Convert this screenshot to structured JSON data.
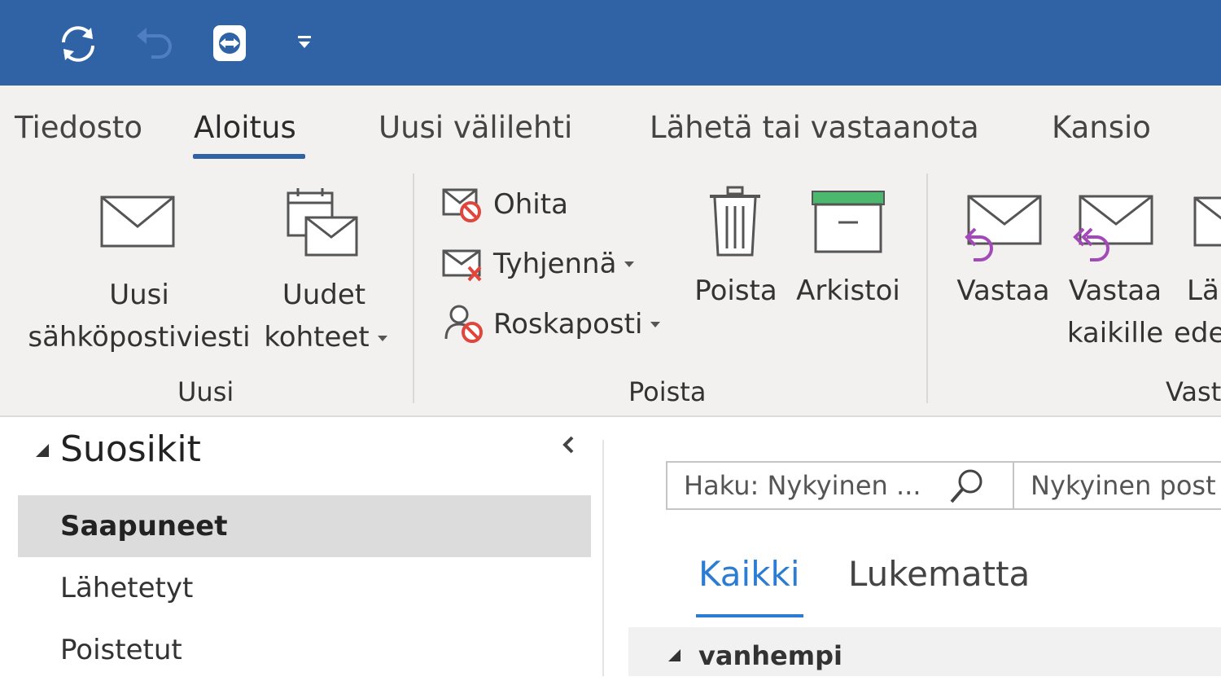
{
  "colors": {
    "titlebar": "#2f63a6",
    "ribbon": "#f2f1f0",
    "accent": "#2b7cd3",
    "reply_purple": "#a24ab8",
    "archive_green": "#4cb86d",
    "block_red": "#e0463c"
  },
  "quick_access": {
    "icons": [
      "sync-icon",
      "undo-icon",
      "teamviewer-icon",
      "customize-quick-access-icon"
    ]
  },
  "tabs": [
    "Tiedosto",
    "Aloitus",
    "Uusi välilehti",
    "Lähetä tai vastaanota",
    "Kansio"
  ],
  "active_tab": "Aloitus",
  "ribbon": {
    "new_email": {
      "line1": "Uusi",
      "line2": "sähköpostiviesti"
    },
    "new_items": {
      "line1": "Uudet",
      "line2": "kohteet"
    },
    "group_new": "Uusi",
    "ignore": "Ohita",
    "clean_up": "Tyhjennä",
    "junk": "Roskaposti",
    "delete": "Poista",
    "archive": "Arkistoi",
    "group_delete": "Poista",
    "reply": "Vastaa",
    "reply_all": {
      "line1": "Vastaa",
      "line2": "kaikille"
    },
    "forward": {
      "line1": "Lä",
      "line2": "ede"
    },
    "group_respond": "Vast"
  },
  "nav": {
    "favorites": "Suosikit",
    "items": [
      {
        "label": "Saapuneet",
        "selected": true
      },
      {
        "label": "Lähetetyt",
        "selected": false
      },
      {
        "label": "Poistetut",
        "selected": false
      }
    ]
  },
  "list": {
    "search_placeholder": "Haku: Nykyinen ...",
    "search_scope": "Nykyinen post",
    "filter_tabs": [
      "Kaikki",
      "Lukematta"
    ],
    "active_filter": "Kaikki",
    "group_header": "vanhempi"
  }
}
